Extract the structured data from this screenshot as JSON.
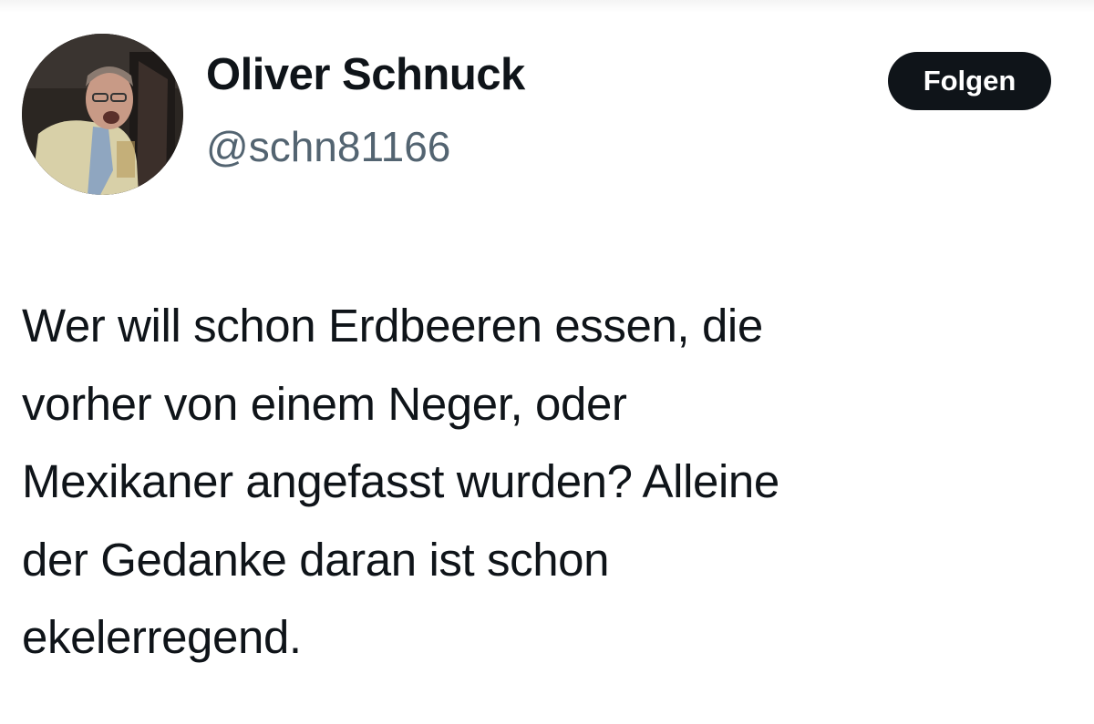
{
  "tweet": {
    "author": {
      "display_name": "Oliver Schnuck",
      "handle": "@schn81166",
      "avatar_icon": "profile-photo"
    },
    "follow_label": "Folgen",
    "text_lines": [
      "Wer will schon Erdbeeren essen, die",
      "vorher von einem Neger, oder",
      "Mexikaner angefasst wurden? Alleine",
      "der Gedanke daran ist schon",
      "ekelerregend."
    ]
  },
  "colors": {
    "text": "#0f1419",
    "secondary_text": "#536471",
    "button_bg": "#0f1419",
    "button_text": "#ffffff",
    "background": "#ffffff"
  }
}
